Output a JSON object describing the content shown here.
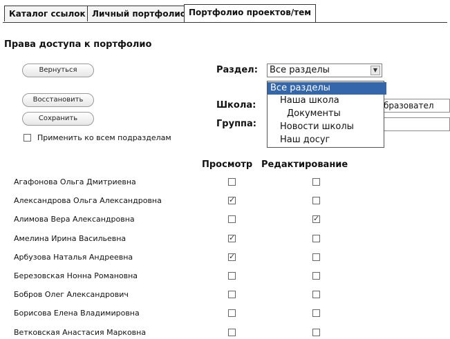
{
  "tabs": [
    "Каталог ссылок",
    "Личный портфолио",
    "Портфолио проектов/тем"
  ],
  "page_title": "Права доступа к портфолио",
  "buttons": {
    "back": "Вернуться",
    "restore": "Восстановить",
    "save": "Сохранить"
  },
  "apply_all_label": "Применить ко всем подразделам",
  "apply_all_checked": false,
  "section": {
    "label": "Раздел:",
    "selected": "Все разделы",
    "options": [
      "Все разделы",
      "Наша школа",
      "Документы",
      "Новости школы",
      "Наш досуг"
    ]
  },
  "school": {
    "label": "Школа:",
    "value": "бразовател"
  },
  "group": {
    "label": "Группа:"
  },
  "columns": {
    "view": "Просмотр",
    "edit": "Редактирование"
  },
  "rows": [
    {
      "name": "Агафонова Ольга Дмитриевна",
      "view": false,
      "edit": false
    },
    {
      "name": "Александрова Ольга Александровна",
      "view": true,
      "edit": false
    },
    {
      "name": "Алимова Вера Александровна",
      "view": false,
      "edit": true
    },
    {
      "name": "Амелина Ирина Васильевна",
      "view": true,
      "edit": false
    },
    {
      "name": "Арбузова Наталья Андреевна",
      "view": true,
      "edit": false
    },
    {
      "name": "Березовская Нонна Романовна",
      "view": false,
      "edit": false
    },
    {
      "name": "Бобров Олег Александрович",
      "view": false,
      "edit": false
    },
    {
      "name": "Борисова Елена Владимировна",
      "view": false,
      "edit": false
    },
    {
      "name": "Ветковская Анастасия Марковна",
      "view": false,
      "edit": false
    }
  ]
}
